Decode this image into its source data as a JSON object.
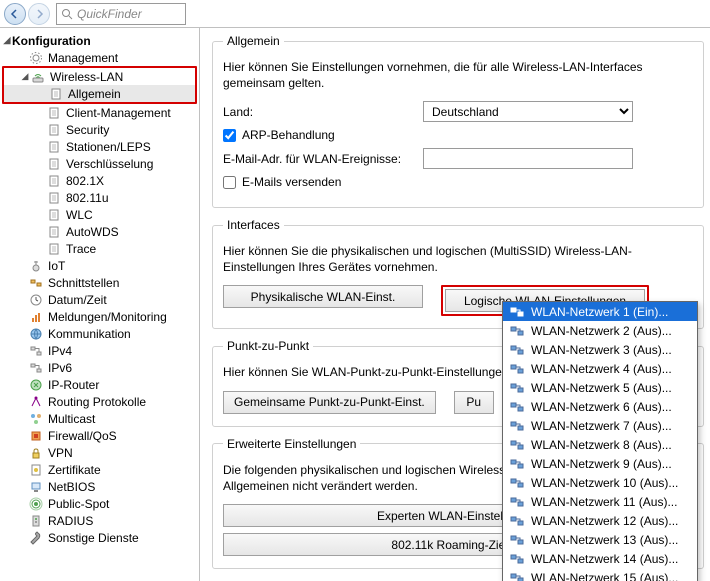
{
  "toolbar": {
    "quickfinder_placeholder": "QuickFinder"
  },
  "tree": {
    "root": "Konfiguration",
    "root_children": [
      {
        "label": "Management",
        "icon": "gear"
      },
      {
        "label": "Wireless-LAN",
        "icon": "wlan",
        "highlight": true,
        "children": [
          {
            "label": "Allgemein",
            "icon": "page",
            "selected": true,
            "highlight": true
          },
          {
            "label": "Client-Management",
            "icon": "page"
          },
          {
            "label": "Security",
            "icon": "page"
          },
          {
            "label": "Stationen/LEPS",
            "icon": "page"
          },
          {
            "label": "Verschlüsselung",
            "icon": "page"
          },
          {
            "label": "802.1X",
            "icon": "page"
          },
          {
            "label": "802.11u",
            "icon": "page"
          },
          {
            "label": "WLC",
            "icon": "page"
          },
          {
            "label": "AutoWDS",
            "icon": "page"
          },
          {
            "label": "Trace",
            "icon": "page"
          }
        ]
      },
      {
        "label": "IoT",
        "icon": "iot"
      },
      {
        "label": "Schnittstellen",
        "icon": "ports"
      },
      {
        "label": "Datum/Zeit",
        "icon": "clock"
      },
      {
        "label": "Meldungen/Monitoring",
        "icon": "chart"
      },
      {
        "label": "Kommunikation",
        "icon": "globe"
      },
      {
        "label": "IPv4",
        "icon": "net"
      },
      {
        "label": "IPv6",
        "icon": "net"
      },
      {
        "label": "IP-Router",
        "icon": "router"
      },
      {
        "label": "Routing Protokolle",
        "icon": "routes"
      },
      {
        "label": "Multicast",
        "icon": "multi"
      },
      {
        "label": "Firewall/QoS",
        "icon": "fire"
      },
      {
        "label": "VPN",
        "icon": "lock"
      },
      {
        "label": "Zertifikate",
        "icon": "cert"
      },
      {
        "label": "NetBIOS",
        "icon": "pc"
      },
      {
        "label": "Public-Spot",
        "icon": "spot"
      },
      {
        "label": "RADIUS",
        "icon": "radius"
      },
      {
        "label": "Sonstige Dienste",
        "icon": "wrench"
      }
    ]
  },
  "sections": {
    "general": {
      "legend": "Allgemein",
      "desc": "Hier können Sie Einstellungen vornehmen, die für alle Wireless-LAN-Interfaces gemeinsam gelten.",
      "country_label": "Land:",
      "country_value": "Deutschland",
      "arp_label": "ARP-Behandlung",
      "arp_checked": true,
      "email_label": "E-Mail-Adr. für WLAN-Ereignisse:",
      "email_value": "",
      "send_mail_label": "E-Mails versenden",
      "send_mail_checked": false
    },
    "interfaces": {
      "legend": "Interfaces",
      "desc": "Hier können Sie die physikalischen und logischen (MultiSSID) Wireless-LAN-Einstellungen Ihres Gerätes vornehmen.",
      "btn_phys": "Physikalische WLAN-Einst.",
      "btn_log": "Logische WLAN-Einstellungen"
    },
    "p2p": {
      "legend": "Punkt-zu-Punkt",
      "desc": "Hier können Sie WLAN-Punkt-zu-Punkt-Einstellungen (P",
      "btn_common": "Gemeinsame Punkt-zu-Punkt-Einst.",
      "btn_partner": "Pu"
    },
    "ext": {
      "legend": "Erweiterte Einstellungen",
      "desc": "Die folgenden physikalischen und logischen Wireless-LA\nAllgemeinen nicht verändert werden.",
      "btn_expert": "Experten WLAN-Einstellungen",
      "btn_roaming": "802.11k Roaming-Ziele..."
    }
  },
  "dropdown": {
    "items": [
      "WLAN-Netzwerk 1 (Ein)...",
      "WLAN-Netzwerk 2 (Aus)...",
      "WLAN-Netzwerk 3 (Aus)...",
      "WLAN-Netzwerk 4 (Aus)...",
      "WLAN-Netzwerk 5 (Aus)...",
      "WLAN-Netzwerk 6 (Aus)...",
      "WLAN-Netzwerk 7 (Aus)...",
      "WLAN-Netzwerk 8 (Aus)...",
      "WLAN-Netzwerk 9 (Aus)...",
      "WLAN-Netzwerk 10 (Aus)...",
      "WLAN-Netzwerk 11 (Aus)...",
      "WLAN-Netzwerk 12 (Aus)...",
      "WLAN-Netzwerk 13 (Aus)...",
      "WLAN-Netzwerk 14 (Aus)...",
      "WLAN-Netzwerk 15 (Aus)..."
    ],
    "selected_index": 0
  }
}
